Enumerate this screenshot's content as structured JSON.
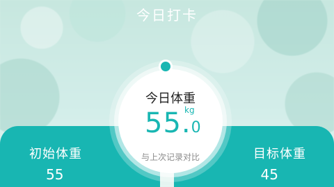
{
  "header": {
    "title": "今日打卡"
  },
  "weight_card": {
    "title": "今日体重",
    "value_int": "55.",
    "value_dec": "0",
    "unit": "kg",
    "compare_label": "与上次记录对比"
  },
  "initial": {
    "label": "初始体重",
    "value": "55"
  },
  "target": {
    "label": "目标体重",
    "value": "45"
  },
  "colors": {
    "accent": "#18b6b2"
  }
}
